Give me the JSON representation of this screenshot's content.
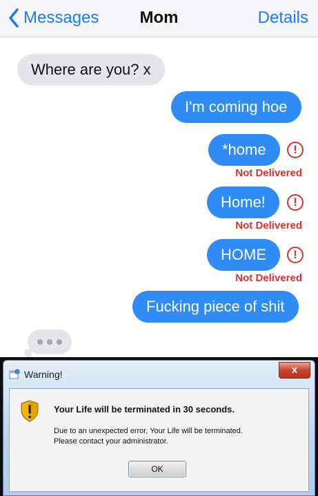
{
  "header": {
    "back_label": "Messages",
    "title": "Mom",
    "details_label": "Details",
    "accent_color": "#1a7cf5"
  },
  "messages": [
    {
      "from": "contact",
      "text": "Where are you? x"
    },
    {
      "from": "me",
      "text": "I'm coming hoe"
    },
    {
      "from": "me",
      "text": "*home",
      "status": "Not Delivered"
    },
    {
      "from": "me",
      "text": "Home!",
      "status": "Not Delivered"
    },
    {
      "from": "me",
      "text": "HOME",
      "status": "Not Delivered"
    },
    {
      "from": "me",
      "text": "Fucking piece of shit"
    }
  ],
  "typing_indicator": true,
  "colors": {
    "incoming_bubble": "#e6e5eb",
    "outgoing_bubble": "#2f8cf4",
    "error": "#e0312f"
  },
  "dialog": {
    "title": "Warning!",
    "close_label": "x",
    "main_text": "Your Life will be terminated in 30 seconds.",
    "detail_line1": "Due to an unexpected error, Your Life will be terminated.",
    "detail_line2": "Please contact your administrator.",
    "ok_label": "OK"
  },
  "icons": {
    "back": "chevron-left-icon",
    "error": "exclamation-circle-icon",
    "dialog_title": "warning-app-icon",
    "dialog_body": "shield-warning-icon"
  }
}
